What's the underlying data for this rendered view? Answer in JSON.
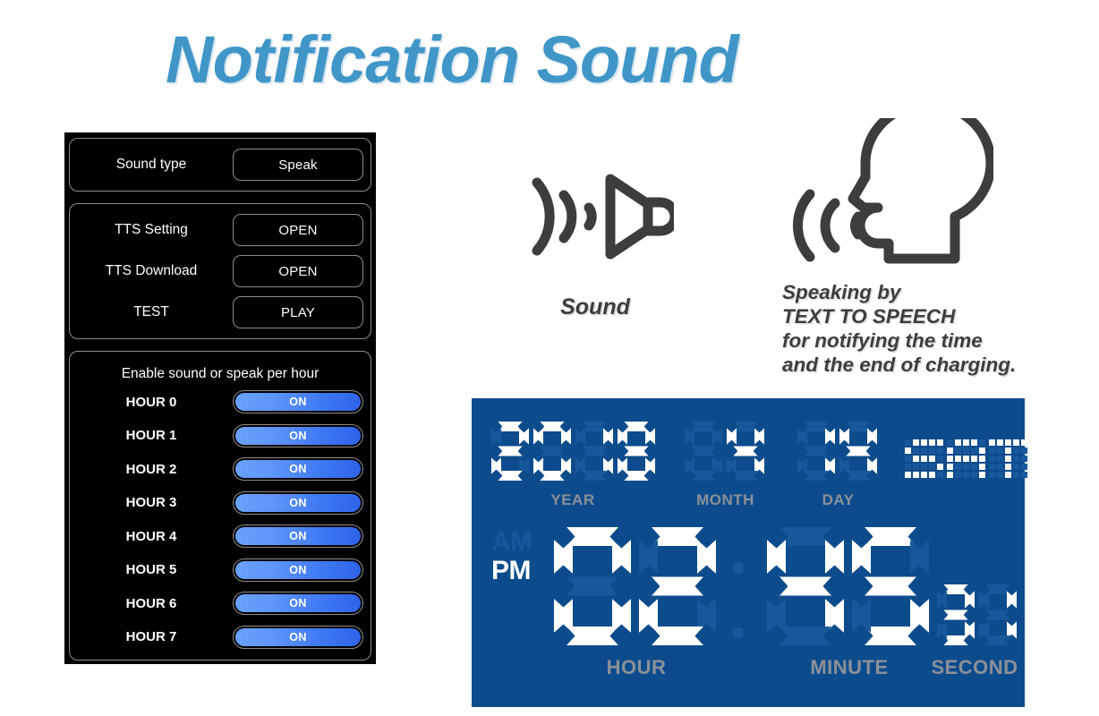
{
  "title": "Notification Sound",
  "colors": {
    "title_blue": "#4196C8",
    "lcd_background": "#0D4C8C",
    "lcd_lit": "#FFFFFF",
    "lcd_dim": "#17589B",
    "lcd_label": "#8C9099",
    "toggle_on_from": "#69A1FB",
    "toggle_on_to": "#2F63E8",
    "panel_background": "#000000",
    "icon_gray": "#3D3D3D"
  },
  "settings": {
    "group_sound_type": {
      "rows": [
        {
          "label": "Sound type",
          "value": "Speak"
        }
      ]
    },
    "group_tts": {
      "rows": [
        {
          "label": "TTS Setting",
          "value": "OPEN"
        },
        {
          "label": "TTS Download",
          "value": "OPEN"
        },
        {
          "label": "TEST",
          "value": "PLAY"
        }
      ]
    },
    "group_hours": {
      "heading": "Enable sound or speak per hour",
      "rows": [
        {
          "label": "HOUR 0",
          "state": "ON"
        },
        {
          "label": "HOUR 1",
          "state": "ON"
        },
        {
          "label": "HOUR 2",
          "state": "ON"
        },
        {
          "label": "HOUR 3",
          "state": "ON"
        },
        {
          "label": "HOUR 4",
          "state": "ON"
        },
        {
          "label": "HOUR 5",
          "state": "ON"
        },
        {
          "label": "HOUR 6",
          "state": "ON"
        },
        {
          "label": "HOUR 7",
          "state": "ON"
        }
      ]
    }
  },
  "sound_feature": {
    "icon": "speaker-waves-icon",
    "caption": "Sound"
  },
  "speech_feature": {
    "icon": "speaking-head-icon",
    "lines": [
      "Speaking by",
      "TEXT TO SPEECH",
      "for notifying the time",
      "and the end of charging."
    ]
  },
  "clock": {
    "year": {
      "value": "2018",
      "label": "YEAR"
    },
    "month": {
      "value": "4",
      "digits": 2,
      "label": "MONTH"
    },
    "day": {
      "value": "14",
      "digits": 2,
      "label": "DAY"
    },
    "weekday": "SAT",
    "meridiem": {
      "am": "AM",
      "pm": "PM",
      "active": "PM"
    },
    "hour": {
      "value": "02",
      "label": "HOUR"
    },
    "minute": {
      "value": "45",
      "label": "MINUTE"
    },
    "second": {
      "value": "31",
      "label": "SECOND"
    }
  }
}
